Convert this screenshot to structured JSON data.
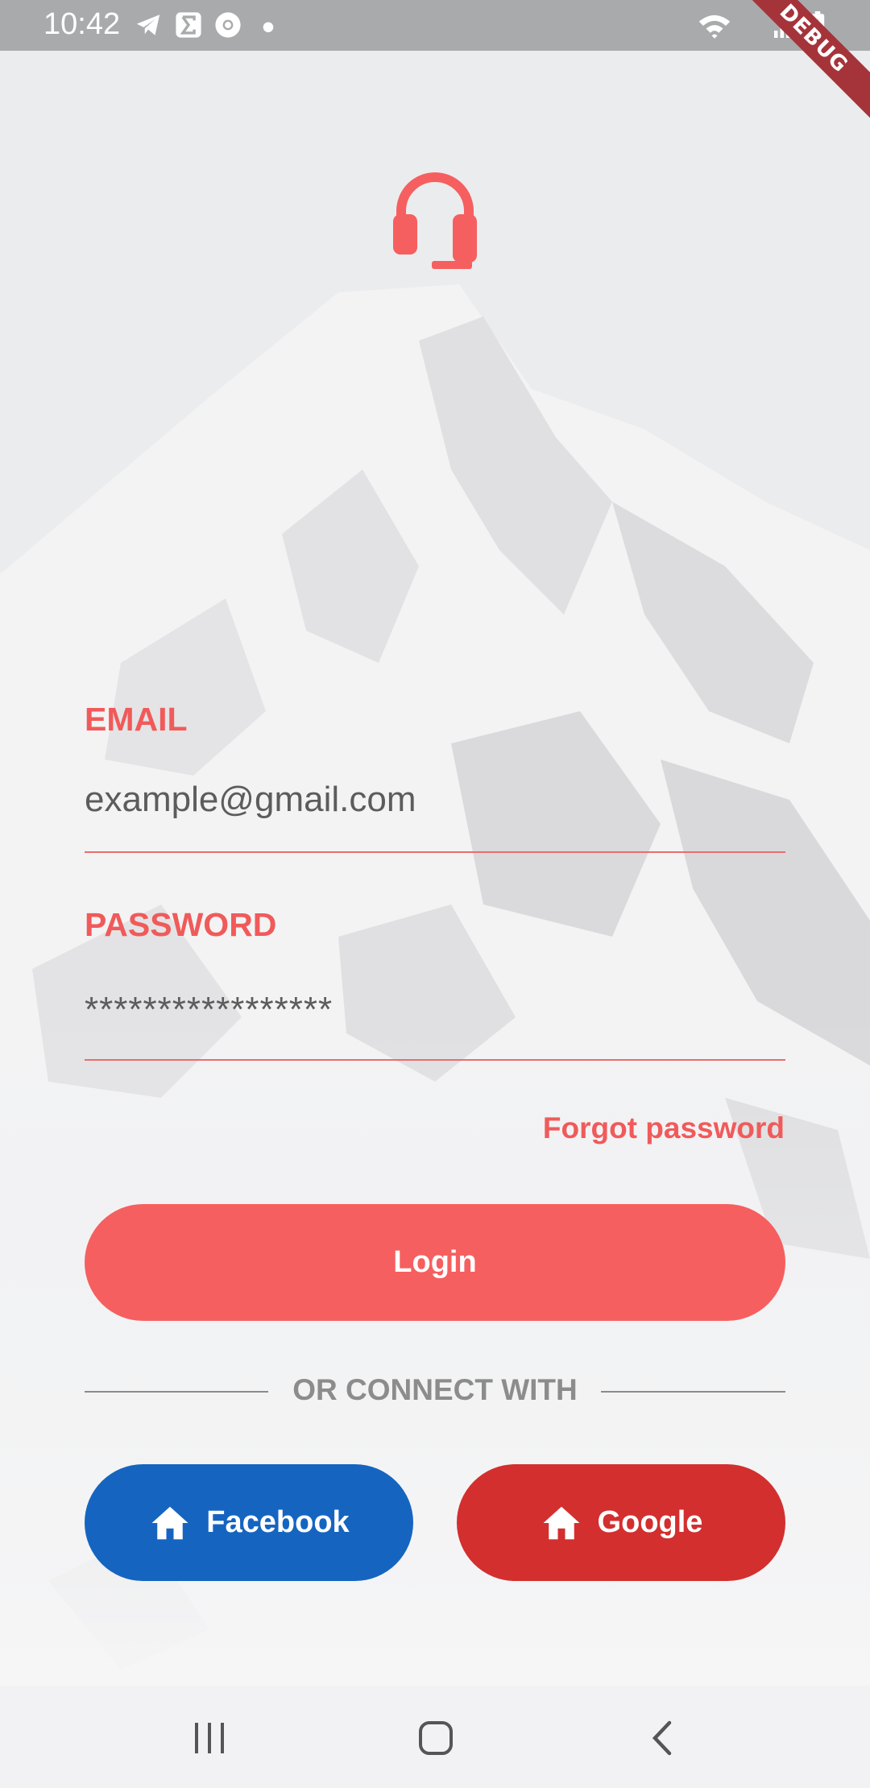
{
  "status_bar": {
    "time": "10:42",
    "debug_label": "DEBUG",
    "icons": [
      "telegram-icon",
      "sigma-icon",
      "chrome-icon",
      "dot-icon",
      "wifi-icon",
      "signal-icon",
      "battery-icon"
    ]
  },
  "form": {
    "email_label": "EMAIL",
    "email_value": "example@gmail.com",
    "password_label": "PASSWORD",
    "password_value": "*****************",
    "forgot_label": "Forgot password"
  },
  "login_label": "Login",
  "divider_text": "OR CONNECT WITH",
  "social": {
    "facebook_label": "Facebook",
    "google_label": "Google"
  },
  "colors": {
    "accent": "#f65f5f",
    "facebook": "#1565c0",
    "google": "#d32f2f"
  },
  "nav": [
    "recent-apps-icon",
    "home-icon",
    "back-icon"
  ]
}
